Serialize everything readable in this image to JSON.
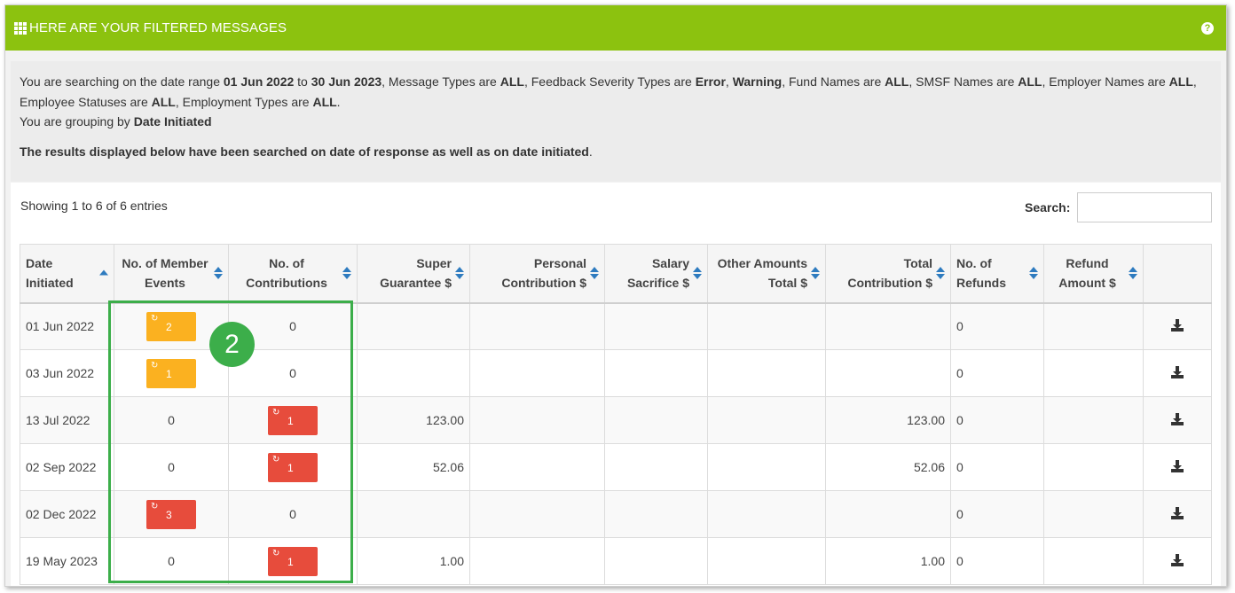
{
  "header": {
    "title": "HERE ARE YOUR FILTERED MESSAGES",
    "help_icon": "question-circle-icon",
    "menu_icon": "grid-icon",
    "color": "#8cc20f"
  },
  "info": {
    "p1": "You are searching on the date range ",
    "date_from": "01 Jun 2022",
    "p2": " to ",
    "date_to": "30 Jun 2023",
    "p3": ", Message Types are ",
    "message_types": "ALL",
    "p4": ", Feedback Severity Types are ",
    "severity_1": "Error",
    "p5": ", ",
    "severity_2": "Warning",
    "p6": ", Fund Names are ",
    "fund_names": "ALL",
    "p7": ", SMSF Names are ",
    "smsf_names": "ALL",
    "p8": ", Employer Names are ",
    "employer_names": "ALL",
    "p9": ", Employee Statuses are ",
    "employee_statuses": "ALL",
    "p10": ", Employment Types are ",
    "employment_types": "ALL",
    "p11": ".",
    "grouping_prefix": "You are grouping by ",
    "grouping": "Date Initiated",
    "note": "The results displayed below have been searched on date of response as well as on date initiated",
    "note_end": "."
  },
  "table": {
    "showing": "Showing 1 to 6 of 6 entries",
    "search_label": "Search:",
    "search_value": "",
    "columns": [
      {
        "line1": "Date",
        "line2": "Initiated"
      },
      {
        "line1": "No. of Member",
        "line2": "Events"
      },
      {
        "line1": "No. of",
        "line2": "Contributions"
      },
      {
        "line1": "Super",
        "line2": "Guarantee $"
      },
      {
        "line1": "Personal",
        "line2": "Contribution $"
      },
      {
        "line1": "Salary",
        "line2": "Sacrifice $"
      },
      {
        "line1": "Other Amounts",
        "line2": "Total $"
      },
      {
        "line1": "Total",
        "line2": "Contribution $"
      },
      {
        "line1": "No. of",
        "line2": "Refunds"
      },
      {
        "line1": "Refund",
        "line2": "Amount $"
      }
    ],
    "rows": [
      {
        "date": "01 Jun 2022",
        "member_events": "2",
        "member_badge": "warn",
        "contributions": "0",
        "contrib_badge": "",
        "super": "",
        "personal": "",
        "salary": "",
        "other": "",
        "total": "",
        "refunds": "0",
        "refund_amount": ""
      },
      {
        "date": "03 Jun 2022",
        "member_events": "1",
        "member_badge": "warn",
        "contributions": "0",
        "contrib_badge": "",
        "super": "",
        "personal": "",
        "salary": "",
        "other": "",
        "total": "",
        "refunds": "0",
        "refund_amount": ""
      },
      {
        "date": "13 Jul 2022",
        "member_events": "0",
        "member_badge": "",
        "contributions": "1",
        "contrib_badge": "err",
        "super": "123.00",
        "personal": "",
        "salary": "",
        "other": "",
        "total": "123.00",
        "refunds": "0",
        "refund_amount": ""
      },
      {
        "date": "02 Sep 2022",
        "member_events": "0",
        "member_badge": "",
        "contributions": "1",
        "contrib_badge": "err",
        "super": "52.06",
        "personal": "",
        "salary": "",
        "other": "",
        "total": "52.06",
        "refunds": "0",
        "refund_amount": ""
      },
      {
        "date": "02 Dec 2022",
        "member_events": "3",
        "member_badge": "err",
        "contributions": "0",
        "contrib_badge": "",
        "super": "",
        "personal": "",
        "salary": "",
        "other": "",
        "total": "",
        "refunds": "0",
        "refund_amount": ""
      },
      {
        "date": "19 May 2023",
        "member_events": "0",
        "member_badge": "",
        "contributions": "1",
        "contrib_badge": "err",
        "super": "1.00",
        "personal": "",
        "salary": "",
        "other": "",
        "total": "1.00",
        "refunds": "0",
        "refund_amount": ""
      }
    ],
    "badge_icon": "refresh-icon",
    "download_icon": "download-icon",
    "colors": {
      "warning": "#fbb120",
      "error": "#e74c3c",
      "sort": "#2e7bbf"
    }
  },
  "annotation": {
    "step": "2",
    "color": "#3cae4a"
  }
}
